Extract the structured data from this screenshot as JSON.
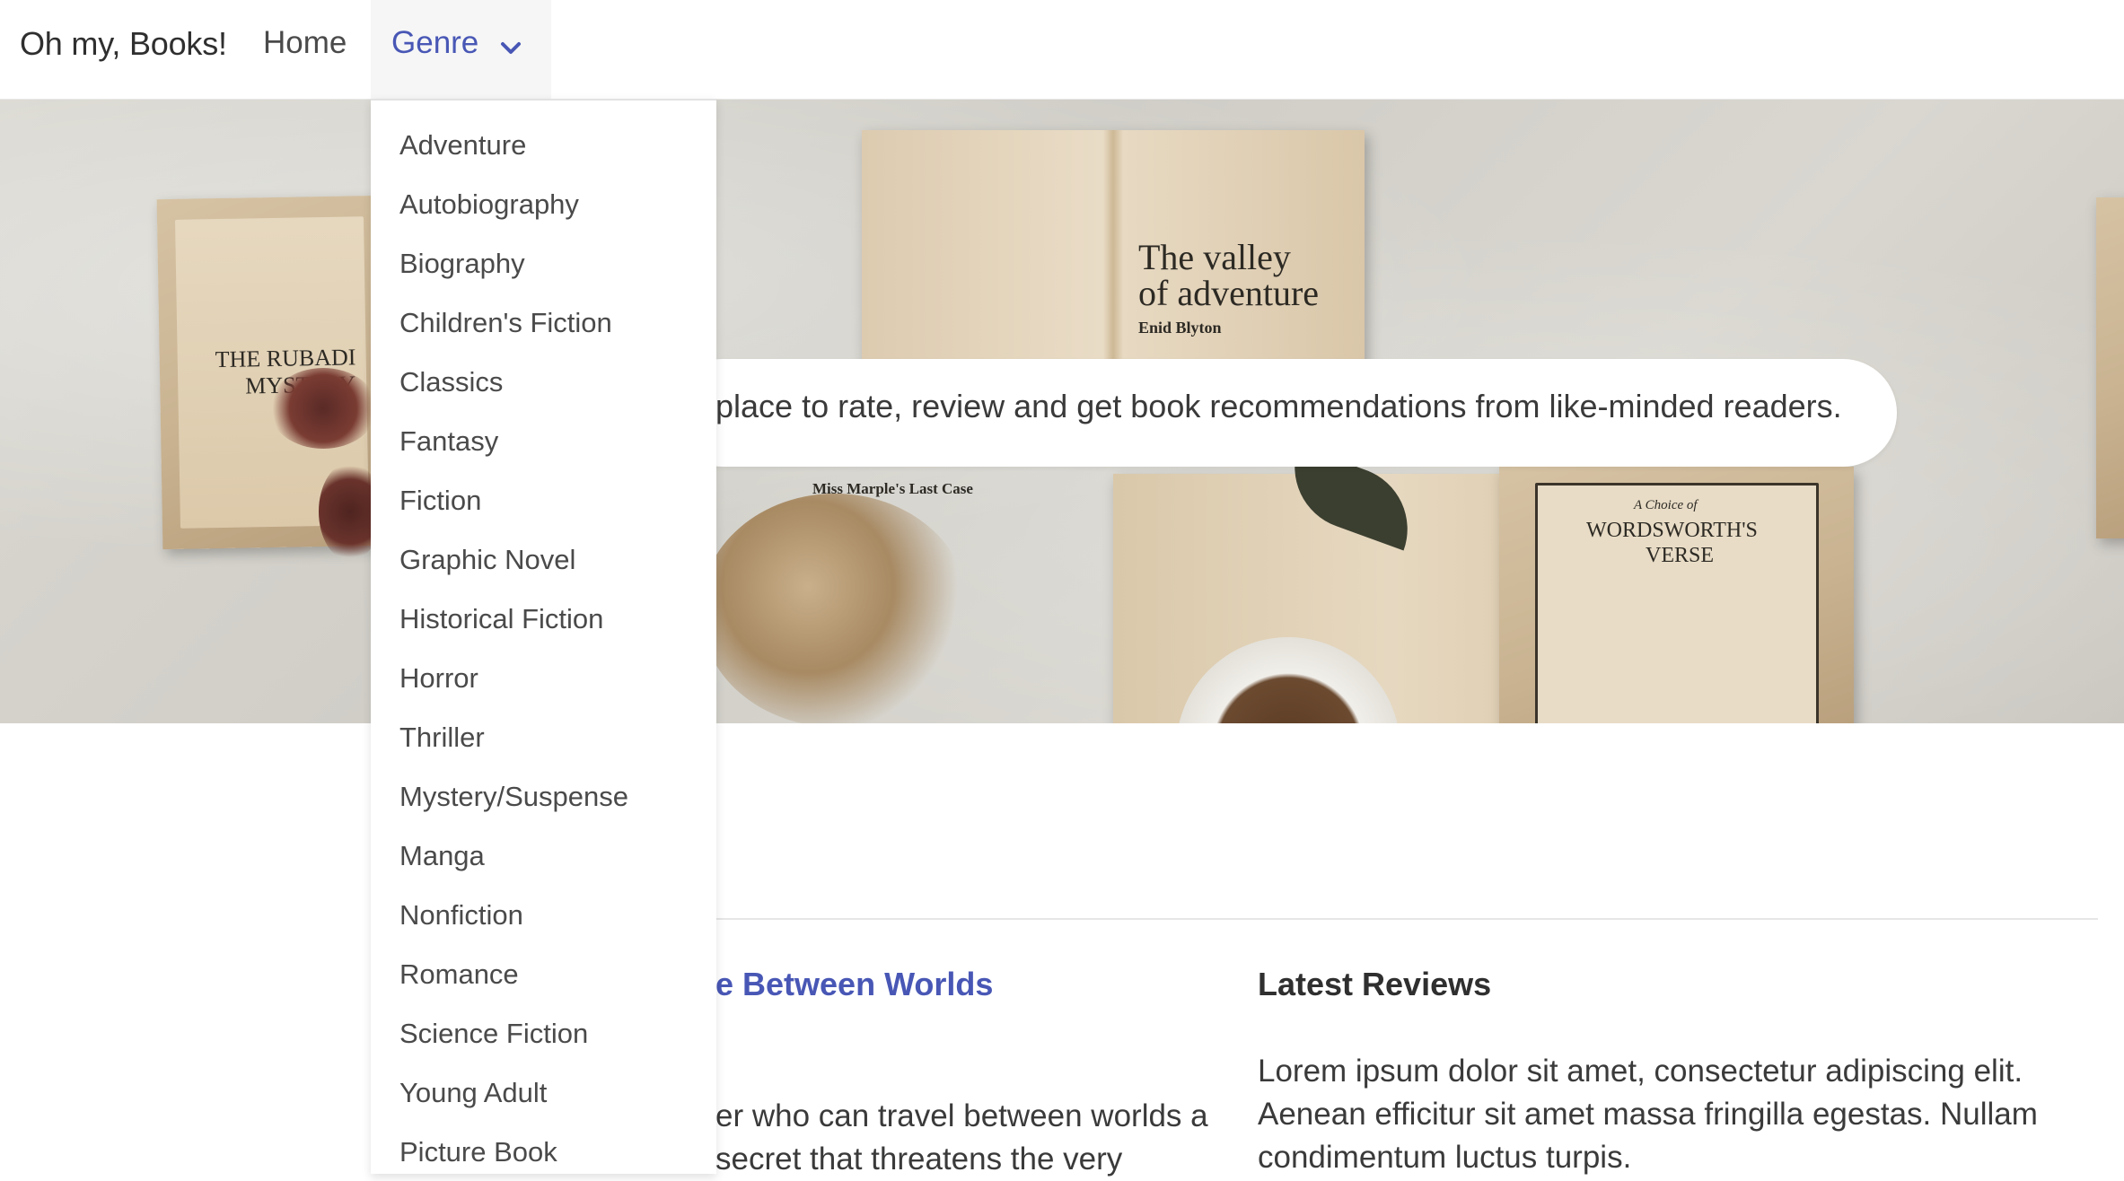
{
  "navbar": {
    "brand": "Oh my, Books!",
    "home": "Home",
    "genre": "Genre",
    "genre_icon": "chevron-down-icon"
  },
  "colors": {
    "accent": "#4857b5",
    "text": "#3a3a3a",
    "dropdown_bg": "#ffffff",
    "genre_active_bg": "#f6f6f6"
  },
  "hero": {
    "tagline": "place to rate, review and get book recommendations from like-minded readers.",
    "book_titles": [
      "THE RUBADI",
      "MYSTERY",
      "The valley",
      "of adventure",
      "Enid Blyton",
      "A Choice of",
      "WORDSWORTH'S",
      "VERSE",
      "Miss Marple's Last Case"
    ]
  },
  "genre_menu": {
    "items": [
      "Adventure",
      "Autobiography",
      "Biography",
      "Children's Fiction",
      "Classics",
      "Fantasy",
      "Fiction",
      "Graphic Novel",
      "Historical Fiction",
      "Horror",
      "Thriller",
      "Mystery/Suspense",
      "Manga",
      "Nonfiction",
      "Romance",
      "Science Fiction",
      "Young Adult",
      "Picture Book"
    ]
  },
  "featured": {
    "title": "e Between Worlds",
    "description": "er who can travel between worlds a secret that threatens the very"
  },
  "reviews": {
    "title": "Latest Reviews",
    "text": "Lorem ipsum dolor sit amet, consectetur adipiscing elit. Aenean efficitur sit amet massa fringilla egestas. Nullam condimentum luctus turpis."
  }
}
